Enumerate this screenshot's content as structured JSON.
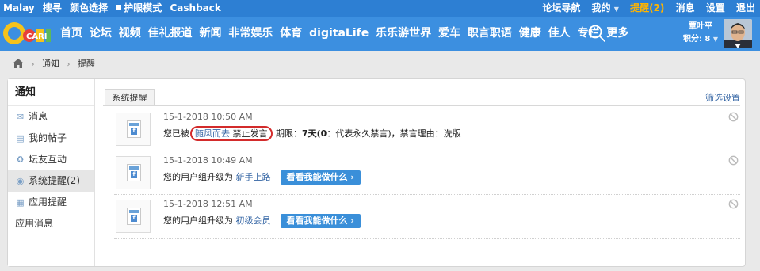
{
  "topbar": {
    "left": [
      "Malay",
      "搜寻",
      "颜色选择",
      "护眼模式",
      "Cashback"
    ],
    "right": {
      "forum_nav": "论坛导航",
      "mine": "我的",
      "alerts": "提醒(2)",
      "messages": "消息",
      "settings": "设置",
      "logout": "退出"
    }
  },
  "nav": {
    "logo": "CARI",
    "items": [
      "首页",
      "论坛",
      "视频",
      "佳礼报道",
      "新闻",
      "非常娱乐",
      "体育",
      "digitaLife",
      "乐乐游世界",
      "爱车",
      "职言职语",
      "健康",
      "佳人",
      "专栏",
      "更多"
    ],
    "user": {
      "name": "覃叶平",
      "points": "积分: 8"
    }
  },
  "breadcrumb": [
    "通知",
    "提醒"
  ],
  "sidebar": {
    "title": "通知",
    "items": [
      {
        "label": "消息",
        "icon": "envelope-icon"
      },
      {
        "label": "我的帖子",
        "icon": "document-icon"
      },
      {
        "label": "坛友互动",
        "icon": "recycle-icon"
      },
      {
        "label": "系统提醒(2)",
        "icon": "system-icon"
      },
      {
        "label": "应用提醒",
        "icon": "grid-icon"
      },
      {
        "label": "应用消息",
        "icon": ""
      }
    ]
  },
  "content": {
    "tab": "系统提醒",
    "filter": "筛选设置",
    "notices": [
      {
        "time": "15-1-2018 10:50 AM",
        "prefix": "您已被",
        "user": "随风而去",
        "action": "禁止发言",
        "rest1": "期限：",
        "term": "7天(0",
        "rest2": "：代表永久禁言)，禁言理由：洗版"
      },
      {
        "time": "15-1-2018 10:49 AM",
        "text": "您的用户组升级为",
        "group": "新手上路",
        "button": "看看我能做什么 ›"
      },
      {
        "time": "15-1-2018 12:51 AM",
        "text": "您的用户组升级为",
        "group": "初级会员",
        "button": "看看我能做什么 ›"
      }
    ]
  },
  "colors": {
    "topbar": "#2d7fd3",
    "navbar": "#3c8fe0",
    "alert": "#ffb400",
    "link": "#3465a4",
    "button": "#3a8fd9",
    "highlight_oval": "#d32b2b"
  }
}
